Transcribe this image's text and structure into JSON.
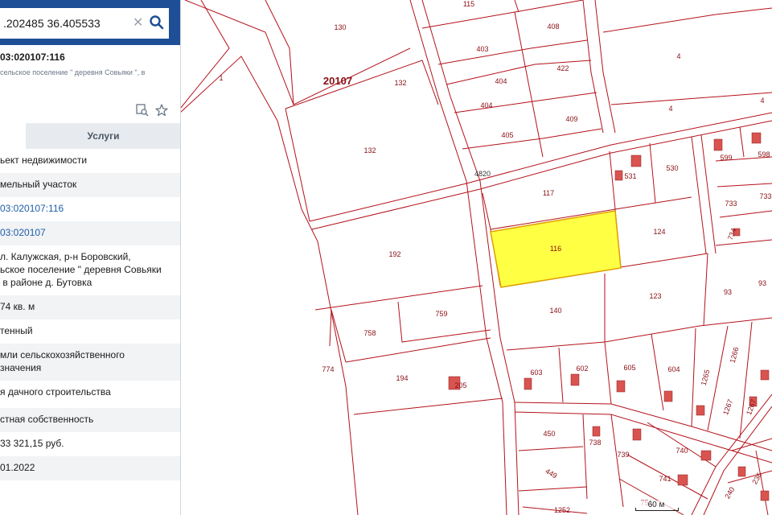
{
  "search": {
    "value": ".202485 36.405533"
  },
  "card": {
    "cad_number": "03:020107:116",
    "address_line": "сельское поселение \" деревня Совьяки \", в"
  },
  "tabs": {
    "services": "Услуги"
  },
  "rows": [
    {
      "text": "ьект недвижимости",
      "alt": false,
      "link": false
    },
    {
      "text": "мельный участок",
      "alt": true,
      "link": false
    },
    {
      "text": "03:020107:116",
      "alt": false,
      "link": true
    },
    {
      "text": "03:020107",
      "alt": true,
      "link": true
    },
    {
      "text": "л. Калужская, р-н Боровский,\nьское поселение \" деревня Совьяки\n в районе д. Бутовка",
      "alt": false,
      "link": false
    },
    {
      "text": "74 кв. м",
      "alt": true,
      "link": false
    },
    {
      "text": "тенный",
      "alt": false,
      "link": false
    },
    {
      "text": "мли сельскохозяйственного\nзначения",
      "alt": true,
      "link": false
    },
    {
      "text": "я дачного строительства",
      "alt": false,
      "link": false
    },
    {
      "text": "стная собственность",
      "alt": true,
      "link": false
    },
    {
      "text": "33 321,15 руб.",
      "alt": false,
      "link": false
    },
    {
      "text": "01.2022",
      "alt": true,
      "link": false
    },
    {
      "text": "",
      "alt": false,
      "link": false
    }
  ],
  "map": {
    "scale_label": "60 м",
    "quarter_label": "20107",
    "road_label": "4820",
    "parcel_line_color": "#b3121b",
    "selected_fill": "#ffff44",
    "selected_stroke": "#e0a000",
    "building_fill": "#d9534f",
    "labels": [
      "1",
      "115",
      "130",
      "408",
      "403",
      "422",
      "404",
      "404",
      "405",
      "409",
      "4",
      "4",
      "4",
      "132",
      "132",
      "117",
      "531",
      "530",
      "599",
      "598",
      "733",
      "733",
      "116",
      "124",
      "734",
      "192",
      "140",
      "123",
      "93",
      "93",
      "759",
      "758",
      "774",
      "194",
      "205",
      "603",
      "602",
      "605",
      "604",
      "1265",
      "1266",
      "1267",
      "1267",
      "450",
      "738",
      "739",
      "740",
      "741",
      "449",
      "751",
      "1252",
      "240",
      "236"
    ],
    "selected_parcel": "116"
  },
  "icons": {
    "search": "search-icon",
    "clear": "close-icon",
    "collapse": "chevron-left-icon",
    "zoom_to": "zoom-to-object-icon",
    "favorite": "star-icon"
  }
}
